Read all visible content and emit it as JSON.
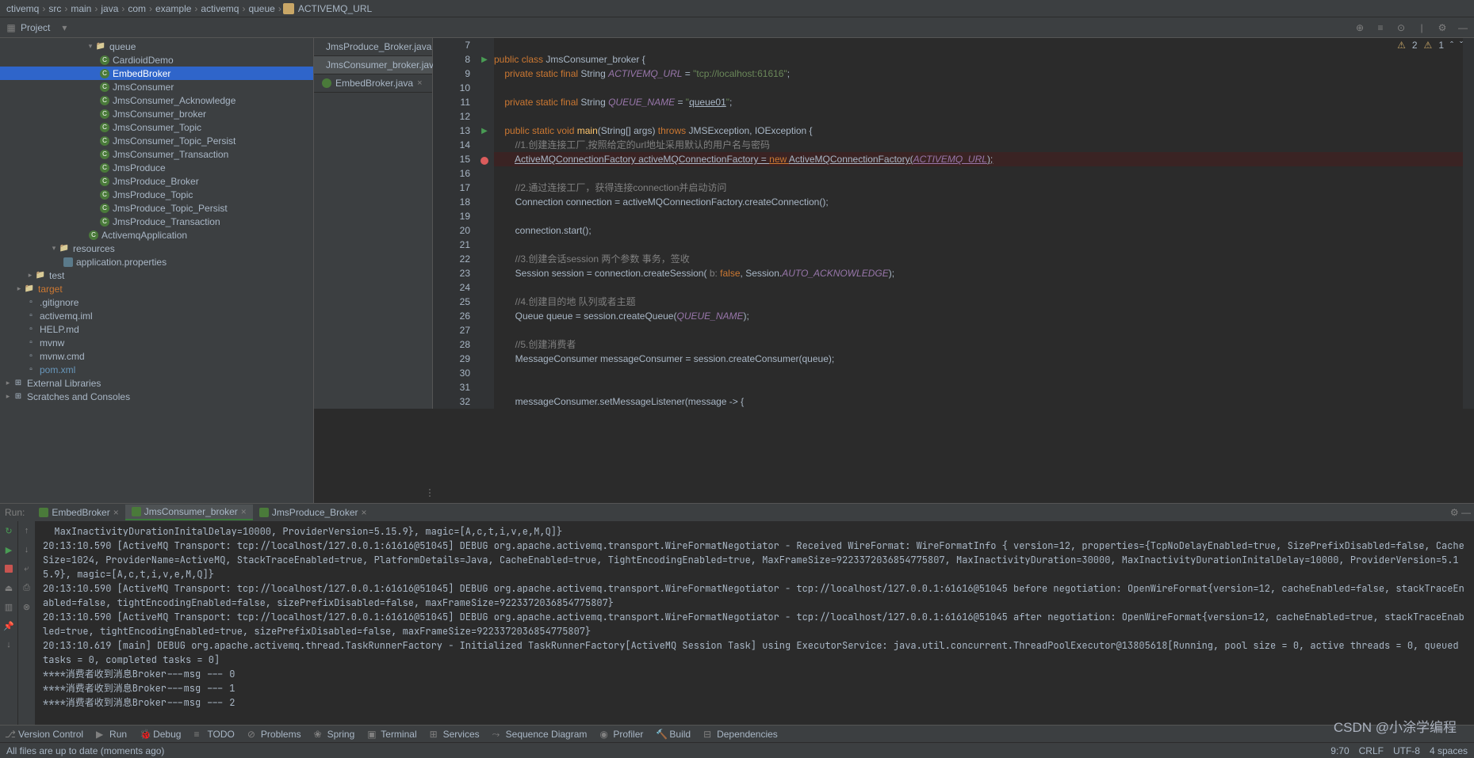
{
  "breadcrumbs": [
    "ctivemq",
    "src",
    "main",
    "java",
    "com",
    "example",
    "activemq",
    "queue",
    "ACTIVEMQ_URL"
  ],
  "project_label": "Project",
  "warnings": {
    "a": "2",
    "b": "1"
  },
  "tree": [
    {
      "indent": 108,
      "arrow": "▾",
      "icon": "folder",
      "label": "queue"
    },
    {
      "indent": 126,
      "icon": "class",
      "label": "CardioidDemo"
    },
    {
      "indent": 126,
      "icon": "class",
      "label": "EmbedBroker",
      "sel": true
    },
    {
      "indent": 126,
      "icon": "class",
      "label": "JmsConsumer"
    },
    {
      "indent": 126,
      "icon": "class",
      "label": "JmsConsumer_Acknowledge"
    },
    {
      "indent": 126,
      "icon": "class",
      "label": "JmsConsumer_broker"
    },
    {
      "indent": 126,
      "icon": "class",
      "label": "JmsConsumer_Topic"
    },
    {
      "indent": 126,
      "icon": "class",
      "label": "JmsConsumer_Topic_Persist"
    },
    {
      "indent": 126,
      "icon": "class",
      "label": "JmsConsumer_Transaction"
    },
    {
      "indent": 126,
      "icon": "class",
      "label": "JmsProduce"
    },
    {
      "indent": 126,
      "icon": "class",
      "label": "JmsProduce_Broker"
    },
    {
      "indent": 126,
      "icon": "class",
      "label": "JmsProduce_Topic"
    },
    {
      "indent": 126,
      "icon": "class",
      "label": "JmsProduce_Topic_Persist"
    },
    {
      "indent": 126,
      "icon": "class",
      "label": "JmsProduce_Transaction"
    },
    {
      "indent": 112,
      "icon": "class",
      "label": "ActivemqApplication"
    },
    {
      "indent": 62,
      "arrow": "▾",
      "icon": "folder",
      "label": "resources"
    },
    {
      "indent": 80,
      "icon": "prop",
      "label": "application.properties"
    },
    {
      "indent": 32,
      "arrow": "▸",
      "icon": "folder",
      "label": "test"
    },
    {
      "indent": 18,
      "arrow": "▸",
      "icon": "folder",
      "label": "target",
      "dark": true
    },
    {
      "indent": 32,
      "icon": "file",
      "label": ".gitignore"
    },
    {
      "indent": 32,
      "icon": "file",
      "label": "activemq.iml"
    },
    {
      "indent": 32,
      "icon": "file",
      "label": "HELP.md"
    },
    {
      "indent": 32,
      "icon": "file",
      "label": "mvnw"
    },
    {
      "indent": 32,
      "icon": "file",
      "label": "mvnw.cmd"
    },
    {
      "indent": 32,
      "icon": "file",
      "label": "pom.xml",
      "blue": true
    },
    {
      "indent": 4,
      "arrow": "▸",
      "icon": "lib",
      "label": "External Libraries"
    },
    {
      "indent": 4,
      "arrow": "▸",
      "icon": "lib",
      "label": "Scratches and Consoles"
    }
  ],
  "editor_tabs": [
    {
      "label": "JmsProduce_Broker.java",
      "active": false
    },
    {
      "label": "JmsConsumer_broker.java",
      "active": true
    },
    {
      "label": "EmbedBroker.java",
      "active": false
    }
  ],
  "gutter_start": 7,
  "gutter_end": 32,
  "gutter_marks": {
    "8": "run",
    "13": "run",
    "15": "bp"
  },
  "code_lines": [
    {
      "n": 7,
      "html": ""
    },
    {
      "n": 8,
      "html": "<span class='kw'>public class </span><span class='type'>JmsConsumer_broker </span>{"
    },
    {
      "n": 9,
      "html": "    <span class='kw'>private static final </span><span class='type'>String </span><span class='field'>ACTIVEMQ_URL</span> = <span class='str'>\"tcp://localhost:61616\"</span>;"
    },
    {
      "n": 10,
      "html": ""
    },
    {
      "n": 11,
      "html": "    <span class='kw'>private static final </span><span class='type'>String </span><span class='field'>QUEUE_NAME</span> = <span class='str'>\"<span class='ul'>queue01</span>\"</span>;"
    },
    {
      "n": 12,
      "html": ""
    },
    {
      "n": 13,
      "html": "    <span class='kw'>public static void </span><span class='method'>main</span>(String[] args) <span class='kw'>throws </span>JMSException, IOException {"
    },
    {
      "n": 14,
      "html": "        <span class='comment'>//1.创建连接工厂,按照给定的url地址采用默认的用户名与密码</span>"
    },
    {
      "n": 15,
      "bp": true,
      "html": "        <span class='ul'>ActiveMQConnectionFactory activeMQConnectionFactory = </span><span class='kw ul'>new </span><span class='ul'>ActiveMQConnectionFactory(</span><span class='field ul'>ACTIVEMQ_URL</span><span class='ul'>);</span>"
    },
    {
      "n": 16,
      "html": ""
    },
    {
      "n": 17,
      "html": "        <span class='comment'>//2.通过连接工厂，获得连接connection并启动访问</span>"
    },
    {
      "n": 18,
      "html": "        Connection connection = activeMQConnectionFactory.createConnection();"
    },
    {
      "n": 19,
      "html": ""
    },
    {
      "n": 20,
      "html": "        connection.start();"
    },
    {
      "n": 21,
      "html": ""
    },
    {
      "n": 22,
      "html": "        <span class='comment'>//3.创建会话session 两个参数 事务，签收</span>"
    },
    {
      "n": 23,
      "html": "        Session session = connection.createSession( <span class='comment'>b:</span> <span class='kw'>false</span>, Session.<span class='field'>AUTO_ACKNOWLEDGE</span>);"
    },
    {
      "n": 24,
      "html": ""
    },
    {
      "n": 25,
      "html": "        <span class='comment'>//4.创建目的地 队列或者主题</span>"
    },
    {
      "n": 26,
      "html": "        Queue queue = session.createQueue(<span class='field'>QUEUE_NAME</span>);"
    },
    {
      "n": 27,
      "html": ""
    },
    {
      "n": 28,
      "html": "        <span class='comment'>//5.创建消费者</span>"
    },
    {
      "n": 29,
      "html": "        MessageConsumer messageConsumer = session.createConsumer(queue);"
    },
    {
      "n": 30,
      "html": ""
    },
    {
      "n": 31,
      "html": ""
    },
    {
      "n": 32,
      "html": "        messageConsumer.setMessageListener(message -> {"
    }
  ],
  "run": {
    "label": "Run:",
    "tabs": [
      {
        "label": "EmbedBroker"
      },
      {
        "label": "JmsConsumer_broker",
        "active": true
      },
      {
        "label": "JmsProduce_Broker"
      }
    ],
    "console": "  MaxInactivityDurationInitalDelay=10000, ProviderVersion=5.15.9}, magic=[A,c,t,i,v,e,M,Q]}\n20:13:10.590 [ActiveMQ Transport: tcp://localhost/127.0.0.1:61616@51045] DEBUG org.apache.activemq.transport.WireFormatNegotiator - Received WireFormat: WireFormatInfo { version=12, properties={TcpNoDelayEnabled=true, SizePrefixDisabled=false, CacheSize=1024, ProviderName=ActiveMQ, StackTraceEnabled=true, PlatformDetails=Java, CacheEnabled=true, TightEncodingEnabled=true, MaxFrameSize=9223372036854775807, MaxInactivityDuration=30000, MaxInactivityDurationInitalDelay=10000, ProviderVersion=5.15.9}, magic=[A,c,t,i,v,e,M,Q]}\n20:13:10.590 [ActiveMQ Transport: tcp://localhost/127.0.0.1:61616@51045] DEBUG org.apache.activemq.transport.WireFormatNegotiator - tcp://localhost/127.0.0.1:61616@51045 before negotiation: OpenWireFormat{version=12, cacheEnabled=false, stackTraceEnabled=false, tightEncodingEnabled=false, sizePrefixDisabled=false, maxFrameSize=9223372036854775807}\n20:13:10.590 [ActiveMQ Transport: tcp://localhost/127.0.0.1:61616@51045] DEBUG org.apache.activemq.transport.WireFormatNegotiator - tcp://localhost/127.0.0.1:61616@51045 after negotiation: OpenWireFormat{version=12, cacheEnabled=true, stackTraceEnabled=true, tightEncodingEnabled=true, sizePrefixDisabled=false, maxFrameSize=9223372036854775807}\n20:13:10.619 [main] DEBUG org.apache.activemq.thread.TaskRunnerFactory - Initialized TaskRunnerFactory[ActiveMQ Session Task] using ExecutorService: java.util.concurrent.ThreadPoolExecutor@13805618[Running, pool size = 0, active threads = 0, queued tasks = 0, completed tasks = 0]\n****消费者收到消息Broker---msg --- 0\n****消费者收到消息Broker---msg --- 1\n****消费者收到消息Broker---msg --- 2\n"
  },
  "bottom": [
    {
      "label": "Version Control",
      "icon": "⎇"
    },
    {
      "label": "Run",
      "icon": "▶"
    },
    {
      "label": "Debug",
      "icon": "🐞"
    },
    {
      "label": "TODO",
      "icon": "≡"
    },
    {
      "label": "Problems",
      "icon": "⊘"
    },
    {
      "label": "Spring",
      "icon": "❀"
    },
    {
      "label": "Terminal",
      "icon": "▣"
    },
    {
      "label": "Services",
      "icon": "⊞"
    },
    {
      "label": "Sequence Diagram",
      "icon": "⤳"
    },
    {
      "label": "Profiler",
      "icon": "◉"
    },
    {
      "label": "Build",
      "icon": "🔨"
    },
    {
      "label": "Dependencies",
      "icon": "⊟"
    }
  ],
  "watermark": "CSDN @小涂学编程",
  "status": {
    "left": "All files are up to date (moments ago)",
    "right": [
      "9:70",
      "CRLF",
      "UTF-8",
      "4 spaces"
    ]
  }
}
